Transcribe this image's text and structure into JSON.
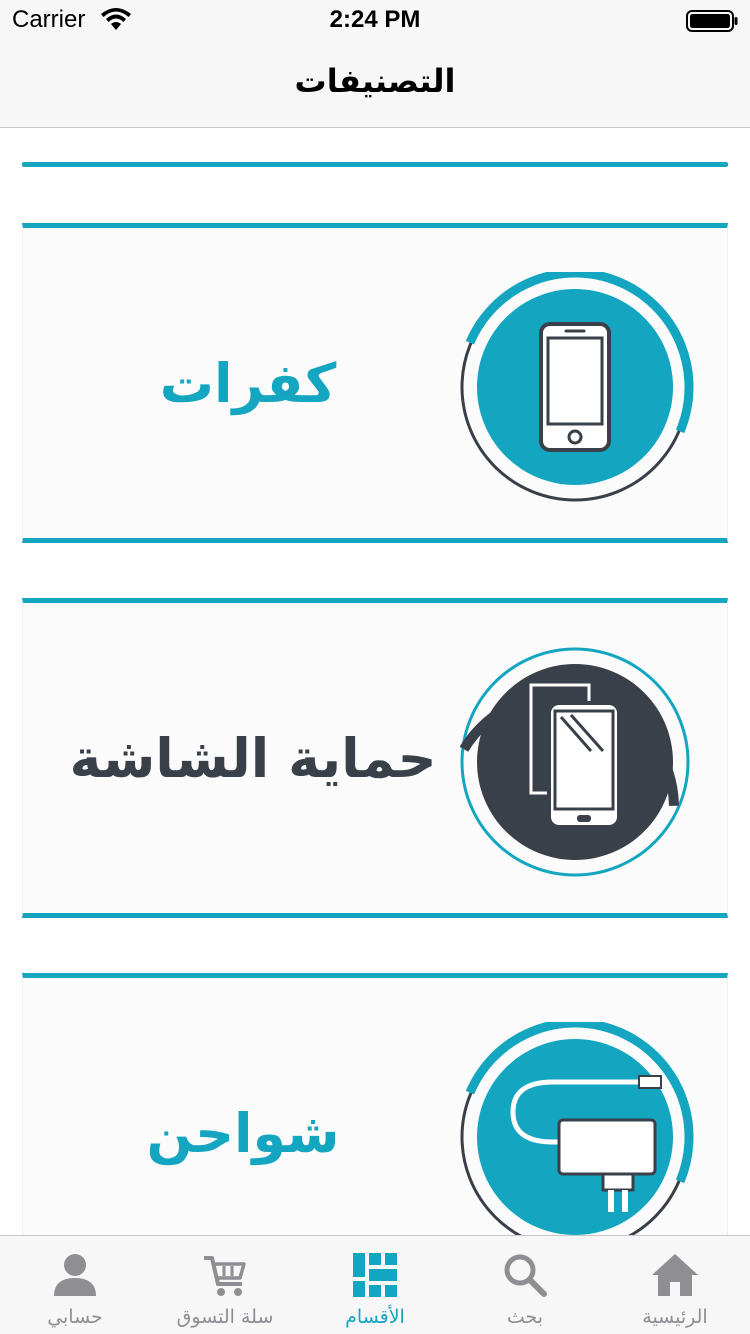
{
  "status_bar": {
    "carrier": "Carrier",
    "time": "2:24 PM"
  },
  "nav": {
    "title": "التصنيفات"
  },
  "categories": [
    {
      "label": "كفرات",
      "icon": "smartphone-icon",
      "label_color": "#14a6c1",
      "circle_color": "#14a6c1"
    },
    {
      "label": "حماية الشاشة",
      "icon": "screen-protector-icon",
      "label_color": "#3a4049",
      "circle_color": "#3a4049"
    },
    {
      "label": "شواحن",
      "icon": "charger-icon",
      "label_color": "#14a6c1",
      "circle_color": "#14a6c1"
    }
  ],
  "tab_bar": {
    "tabs": [
      {
        "label": "حسابي",
        "icon": "person-icon",
        "active": false
      },
      {
        "label": "سلة التسوق",
        "icon": "cart-icon",
        "active": false
      },
      {
        "label": "الأقسام",
        "icon": "grid-icon",
        "active": true
      },
      {
        "label": "بحث",
        "icon": "search-icon",
        "active": false
      },
      {
        "label": "الرئيسية",
        "icon": "home-icon",
        "active": false
      }
    ]
  },
  "colors": {
    "accent": "#14a6c1",
    "dark": "#3a4049",
    "inactive": "#8e8e93"
  }
}
